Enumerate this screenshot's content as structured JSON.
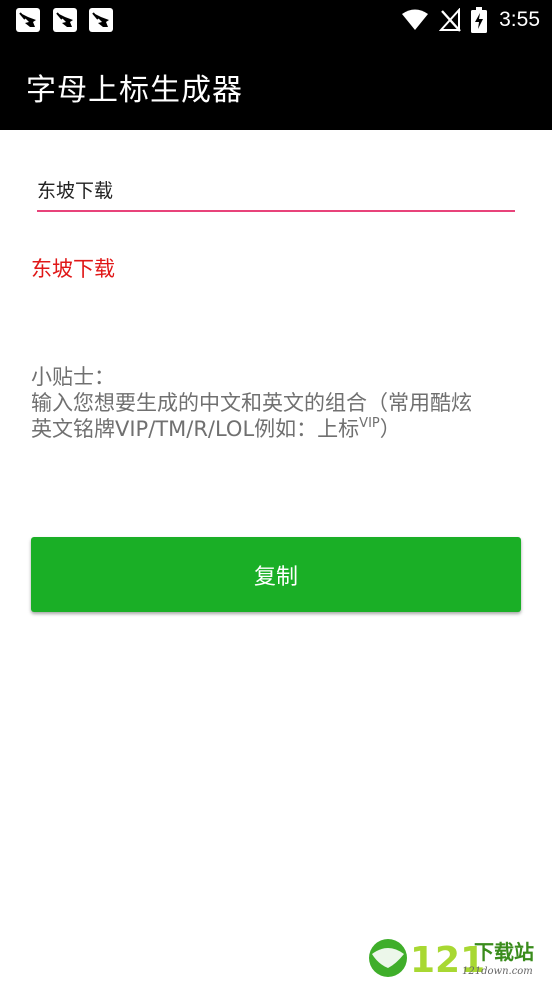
{
  "status_bar": {
    "time": "3:55",
    "notification_icons": [
      "bird-icon",
      "bird-icon",
      "bird-icon"
    ],
    "wifi_icon": "wifi-icon",
    "signal_icon": "no-signal-icon",
    "battery_icon": "battery-charging-icon"
  },
  "app_bar": {
    "title": "字母上标生成器"
  },
  "input": {
    "value": "东坡下载",
    "underline_color": "#e8437a"
  },
  "result": {
    "text": "东坡下载",
    "color": "#e01818"
  },
  "tips": {
    "heading": "小贴士：",
    "line1": "输入您想要生成的中文和英文的组合（常用酷炫",
    "line2_prefix": "英文铭牌VIP/TM/R/LOL例如：上标",
    "line2_sup": "VIP",
    "line2_suffix": "）"
  },
  "copy_button": {
    "label": "复制",
    "color": "#1aaf26"
  },
  "watermark": {
    "number": "121",
    "brand": "下载站",
    "domain": "121down.com"
  }
}
